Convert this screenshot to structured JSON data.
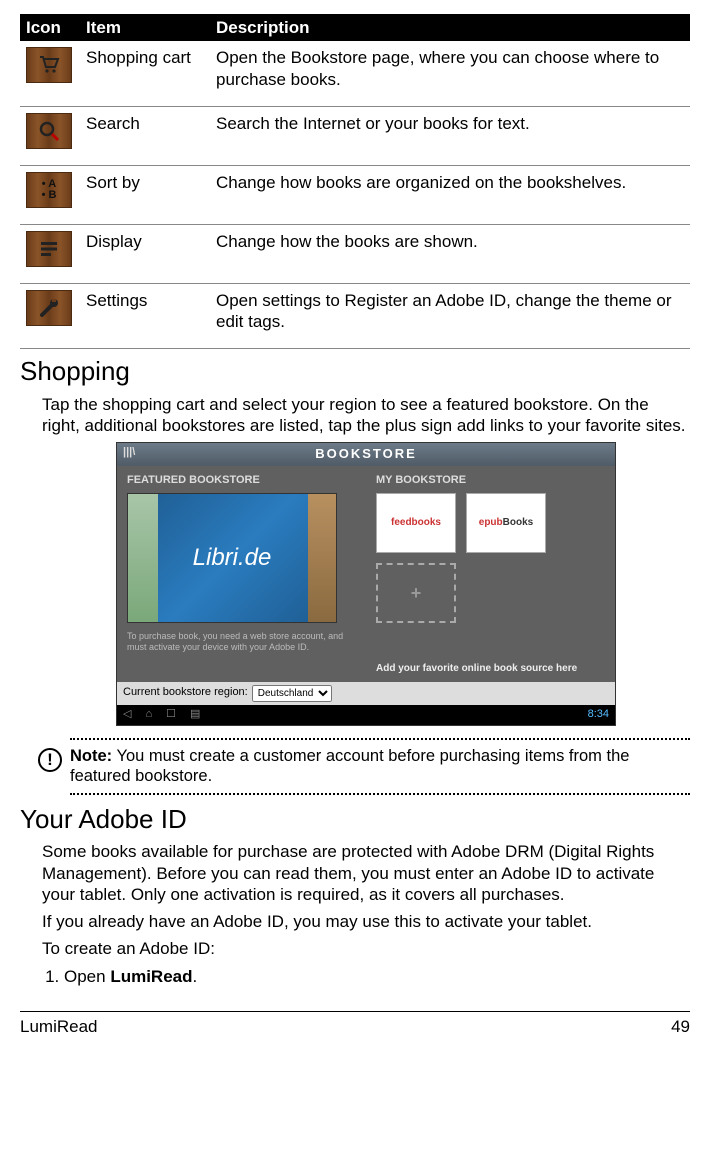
{
  "table": {
    "headers": {
      "icon": "Icon",
      "item": "Item",
      "desc": "Description"
    },
    "rows": [
      {
        "icon": "cart",
        "item": "Shopping cart",
        "desc": "Open the Bookstore page, where you can choose where to purchase books."
      },
      {
        "icon": "search",
        "item": "Search",
        "desc": "Search the Internet or your books for text."
      },
      {
        "icon": "sort",
        "item": "Sort by",
        "desc": "Change how books are organized on the bookshelves."
      },
      {
        "icon": "display",
        "item": "Display",
        "desc": "Change how the books are shown."
      },
      {
        "icon": "settings",
        "item": "Settings",
        "desc": "Open settings to Register an Adobe ID, change the theme or edit tags."
      }
    ]
  },
  "shopping": {
    "heading": "Shopping",
    "para": "Tap the shopping cart and select your region to see a featured bookstore. On the right, additional bookstores are listed, tap the plus sign add links to your favorite sites."
  },
  "screenshot": {
    "title": "BOOKSTORE",
    "back": "|||\\",
    "featured_header": "FEATURED BOOKSTORE",
    "my_header": "MY BOOKSTORE",
    "featured_name": "Libri.de",
    "purchase_note": "To purchase book, you need a web store account, and must activate your device with your Adobe ID.",
    "region_label": "Current bookstore region:",
    "region_value": "Deutschland",
    "tile1": "feedbooks",
    "tile2_prefix": "epub",
    "tile2_suffix": "Books",
    "add_tile": "+",
    "add_note": "Add your favorite online book source here",
    "clock": "8:34"
  },
  "note": {
    "label": "Note:",
    "text": " You must create a customer account before purchasing items from the featured bookstore."
  },
  "adobe": {
    "heading": "Your Adobe ID",
    "p1": "Some books available for purchase are protected with Adobe DRM (Digital Rights Management). Before you can read them, you must enter an Adobe ID to activate your tablet. Only one activation is required, as it covers all purchases.",
    "p2": "If you already have an Adobe ID, you may use this to activate your tablet.",
    "p3": "To create an Adobe ID:",
    "step1_pre": "Open ",
    "step1_bold": "LumiRead",
    "step1_post": "."
  },
  "footer": {
    "title": "LumiRead",
    "page": "49"
  }
}
